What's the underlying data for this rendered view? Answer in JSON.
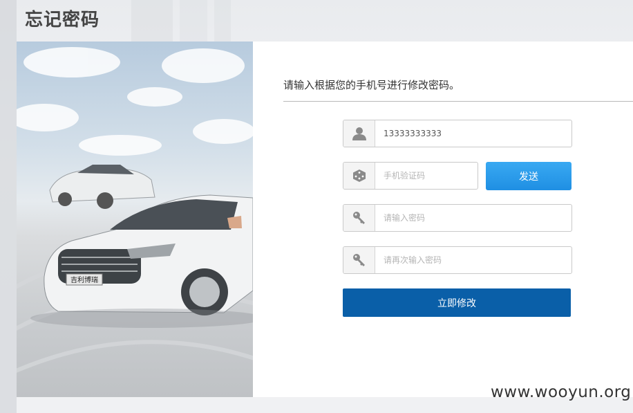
{
  "header": {
    "title": "忘记密码"
  },
  "form": {
    "instruction": "请输入根据您的手机号进行修改密码。",
    "phone": {
      "value": "13333333333",
      "icon": "user-icon"
    },
    "code": {
      "placeholder": "手机验证码",
      "icon": "dice-icon"
    },
    "send_label": "发送",
    "password": {
      "placeholder": "请输入密码",
      "icon": "key-icon"
    },
    "password_confirm": {
      "placeholder": "请再次输入密码",
      "icon": "key-icon"
    },
    "submit_label": "立即修改"
  },
  "banner": {
    "car_badge": "吉利博瑞"
  },
  "watermark": "www.wooyun.org",
  "colors": {
    "send_button": "#1f8fe3",
    "submit_button": "#0a5fa8"
  }
}
